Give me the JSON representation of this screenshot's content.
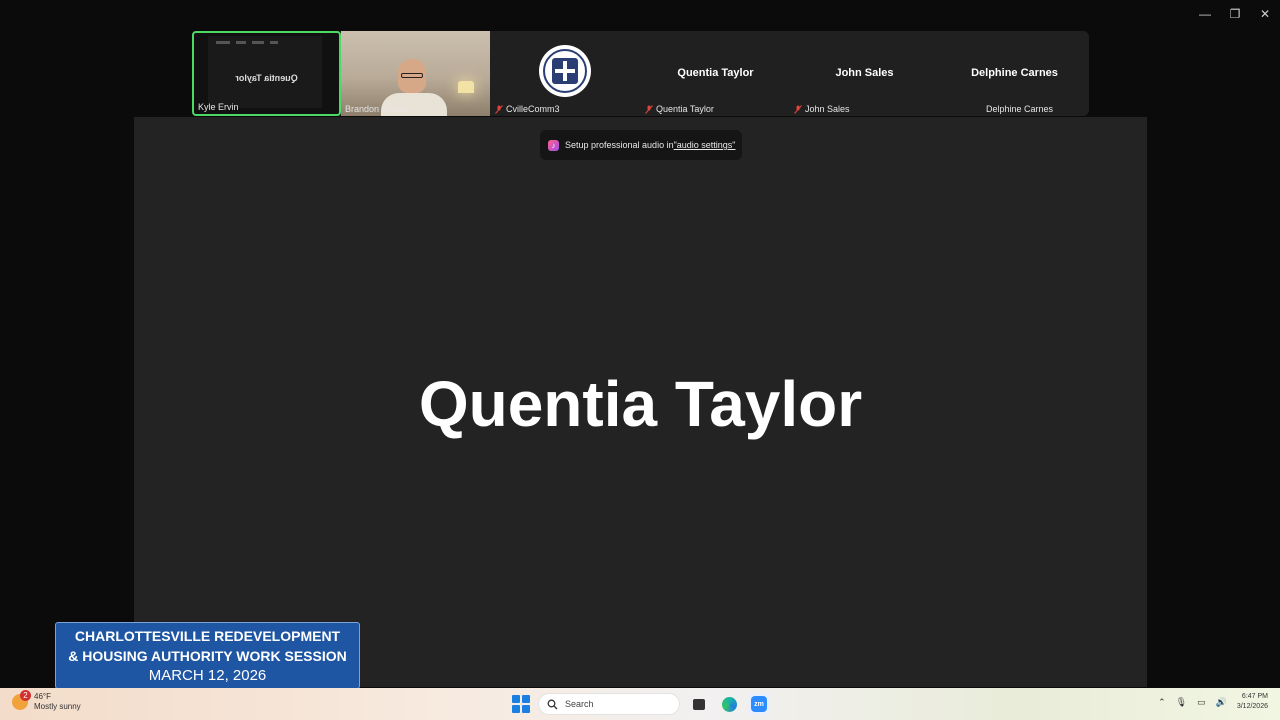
{
  "window_controls": {
    "minimize": "—",
    "restore": "❐",
    "close": "✕"
  },
  "participants": {
    "kyle": {
      "name": "Kyle Ervin",
      "shared_text": "Quentia Taylor"
    },
    "brandon": {
      "name": "Brandon Collins"
    },
    "cville": {
      "name": "CvilleComm3"
    },
    "quentia": {
      "title": "Quentia Taylor",
      "name": "Quentia Taylor"
    },
    "john": {
      "title": "John Sales",
      "name": "John Sales"
    },
    "delphine": {
      "title": "Delphine Carnes",
      "name": "Delphine Carnes"
    }
  },
  "toast": {
    "text": "Setup professional audio in ",
    "link": "\"audio settings\""
  },
  "active_speaker": "Quentia Taylor",
  "banner": {
    "line1": "CHARLOTTESVILLE REDEVELOPMENT",
    "line2": "& HOUSING AUTHORITY WORK SESSION",
    "line3": "MARCH 12, 2026"
  },
  "taskbar": {
    "weather_badge": "2",
    "temperature": "46°F",
    "condition": "Mostly sunny",
    "search_label": "Search",
    "zoom_label": "zm",
    "time": "6:47 PM",
    "date": "3/12/2026"
  }
}
